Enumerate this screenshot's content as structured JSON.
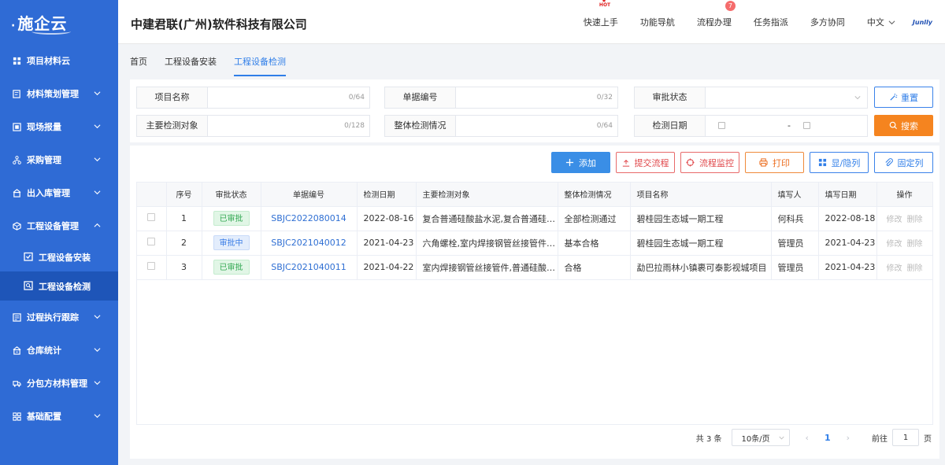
{
  "sidebar": {
    "logo": "施企云",
    "items": [
      {
        "label": "项目材料云",
        "icon": "grid-icon"
      },
      {
        "label": "材料策划管理",
        "icon": "plan-icon"
      },
      {
        "label": "现场报量",
        "icon": "report-icon"
      },
      {
        "label": "采购管理",
        "icon": "org-icon"
      },
      {
        "label": "出入库管理",
        "icon": "warehouse-icon"
      },
      {
        "label": "工程设备管理",
        "icon": "box-icon"
      },
      {
        "label": "过程执行跟踪",
        "icon": "track-icon"
      },
      {
        "label": "仓库统计",
        "icon": "stats-icon"
      },
      {
        "label": "分包方材料管理",
        "icon": "truck-icon"
      },
      {
        "label": "基础配置",
        "icon": "config-icon"
      }
    ],
    "subitems": [
      {
        "label": "工程设备安装",
        "icon": "check-doc-icon"
      },
      {
        "label": "工程设备检测",
        "icon": "inspect-icon"
      }
    ]
  },
  "header": {
    "company": "中建君联(广州)软件科技有限公司",
    "nav": [
      "快速上手",
      "功能导航",
      "流程办理",
      "任务指派",
      "多方协同"
    ],
    "hot_badge": "HOT",
    "process_count": "7",
    "language": "中文",
    "brand": "Junlly"
  },
  "tabs": [
    "首页",
    "工程设备安装",
    "工程设备检测"
  ],
  "filter": {
    "project_name": {
      "label": "项目名称",
      "count": "0/64"
    },
    "doc_no": {
      "label": "单据编号",
      "count": "0/32"
    },
    "approval_status": {
      "label": "审批状态"
    },
    "inspect_object": {
      "label": "主要检测对象",
      "count": "0/128"
    },
    "overall_result": {
      "label": "整体检测情况",
      "count": "0/64"
    },
    "inspect_date": {
      "label": "检测日期",
      "separator": "-"
    },
    "reset": "重置",
    "search": "搜索"
  },
  "toolbar": {
    "add": "添加",
    "submit_flow": "提交流程",
    "monitor_flow": "流程监控",
    "print": "打印",
    "toggle_cols": "显/隐列",
    "fix_cols": "固定列"
  },
  "table": {
    "columns": [
      "序号",
      "审批状态",
      "单据编号",
      "检测日期",
      "主要检测对象",
      "整体检测情况",
      "项目名称",
      "填写人",
      "填写日期",
      "操作"
    ],
    "rows": [
      {
        "no": "1",
        "status": "已审批",
        "status_color": "green",
        "doc_no": "SBJC2022080014",
        "date": "2022-08-16",
        "object": "复合普通硅酸盐水泥,复合普通硅酸盐水泥",
        "result": "全部检测通过",
        "project": "碧桂园生态城一期工程",
        "writer": "何科兵",
        "write_date": "2022-08-18",
        "edit": "修改",
        "delete": "删除"
      },
      {
        "no": "2",
        "status": "审批中",
        "status_color": "blue",
        "doc_no": "SBJC2021040012",
        "date": "2021-04-23",
        "object": "六角螺栓,室内焊接钢管丝接管件,普通硅酸盐水泥",
        "result": "基本合格",
        "project": "碧桂园生态城一期工程",
        "writer": "管理员",
        "write_date": "2021-04-23",
        "edit": "修改",
        "delete": "删除"
      },
      {
        "no": "3",
        "status": "已审批",
        "status_color": "green",
        "doc_no": "SBJC2021040011",
        "date": "2021-04-22",
        "object": "室内焊接钢管丝接管件,普通硅酸盐水泥",
        "result": "合格",
        "project": "勐巴拉雨林小镇裹可泰影视城项目",
        "writer": "管理员",
        "write_date": "2021-04-23",
        "edit": "修改",
        "delete": "删除"
      }
    ]
  },
  "pager": {
    "total": "共 3 条",
    "page_size": "10条/页",
    "current": "1",
    "goto_label": "前往",
    "goto_value": "1",
    "page_suffix": "页"
  }
}
